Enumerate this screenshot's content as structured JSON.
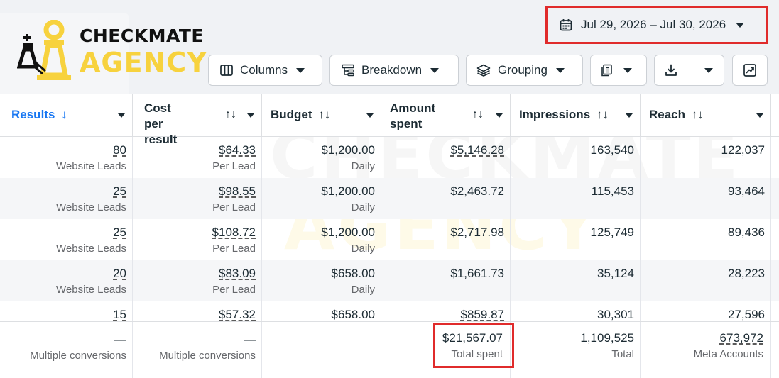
{
  "brand": {
    "line1": "CHECKMATE",
    "line2": "AGENCY",
    "accent": "#f7d23e"
  },
  "toolbar": {
    "date_range": "Jul 29, 2026 – Jul 30, 2026",
    "columns_label": "Columns",
    "breakdown_label": "Breakdown",
    "grouping_label": "Grouping"
  },
  "columns": [
    {
      "label": "Results",
      "sort": "↓"
    },
    {
      "label": "Cost per result",
      "sort": "↑↓"
    },
    {
      "label": "Budget",
      "sort": "↑↓"
    },
    {
      "label": "Amount spent",
      "sort": "↑↓"
    },
    {
      "label": "Impressions",
      "sort": "↑↓"
    },
    {
      "label": "Reach",
      "sort": "↑↓"
    }
  ],
  "rows": [
    {
      "results": "80",
      "results_sub": "Website Leads",
      "cpr": "$64.33",
      "cpr_sub": "Per Lead",
      "budget": "$1,200.00",
      "budget_sub": "Daily",
      "spent": "$5,146.28",
      "impressions": "163,540",
      "reach": "122,037"
    },
    {
      "results": "25",
      "results_sub": "Website Leads",
      "cpr": "$98.55",
      "cpr_sub": "Per Lead",
      "budget": "$1,200.00",
      "budget_sub": "Daily",
      "spent": "$2,463.72",
      "impressions": "115,453",
      "reach": "93,464"
    },
    {
      "results": "25",
      "results_sub": "Website Leads",
      "cpr": "$108.72",
      "cpr_sub": "Per Lead",
      "budget": "$1,200.00",
      "budget_sub": "Daily",
      "spent": "$2,717.98",
      "impressions": "125,749",
      "reach": "89,436"
    },
    {
      "results": "20",
      "results_sub": "Website Leads",
      "cpr": "$83.09",
      "cpr_sub": "Per Lead",
      "budget": "$658.00",
      "budget_sub": "Daily",
      "spent": "$1,661.73",
      "impressions": "35,124",
      "reach": "28,223"
    },
    {
      "results": "15",
      "results_sub": "",
      "cpr": "$57.32",
      "cpr_sub": "",
      "budget": "$658.00",
      "budget_sub": "",
      "spent": "$859.87",
      "impressions": "30,301",
      "reach": "27,596"
    }
  ],
  "totals": {
    "results": "—",
    "results_sub": "Multiple conversions",
    "cpr": "—",
    "cpr_sub": "Multiple conversions",
    "spent": "$21,567.07",
    "spent_sub": "Total spent",
    "impressions": "1,109,525",
    "impressions_sub": "Total",
    "reach": "673,972",
    "reach_sub": "Meta Accounts"
  },
  "colors": {
    "highlight": "#e02b2b",
    "results_header": "#1877f2",
    "border": "#ccd0d5"
  }
}
